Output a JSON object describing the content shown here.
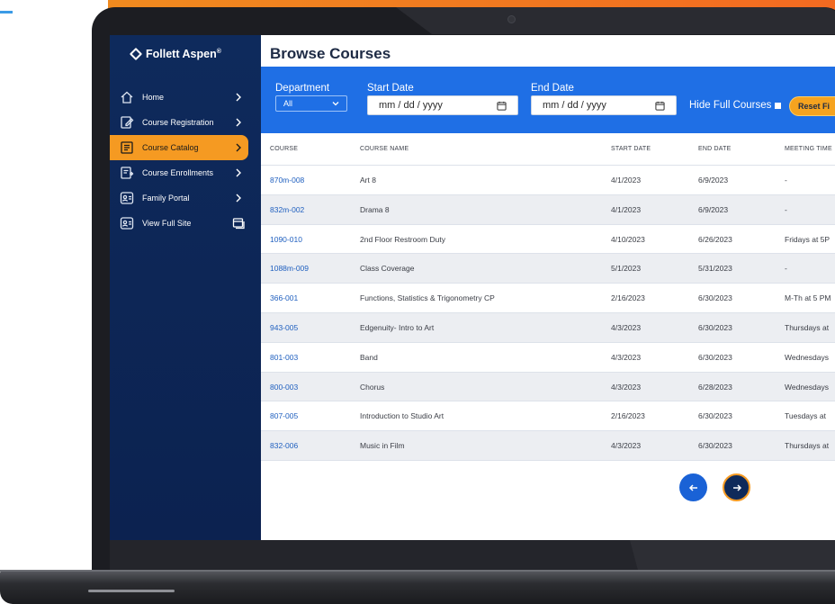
{
  "app": {
    "logo_text": "Follett Aspen",
    "logo_reg": "®"
  },
  "sidebar": {
    "items": [
      {
        "label": "Home",
        "icon": "home-icon",
        "active": false
      },
      {
        "label": "Course Registration",
        "icon": "edit-document-icon",
        "active": false
      },
      {
        "label": "Course Catalog",
        "icon": "catalog-icon",
        "active": true
      },
      {
        "label": "Course Enrollments",
        "icon": "enrollment-icon",
        "active": false
      },
      {
        "label": "Family Portal",
        "icon": "family-icon",
        "active": false
      },
      {
        "label": "View Full Site",
        "icon": "family-icon",
        "active": false
      }
    ]
  },
  "page": {
    "title": "Browse Courses"
  },
  "filters": {
    "department_label": "Department",
    "department_value": "All",
    "start_date_label": "Start Date",
    "start_date_placeholder": "mm / dd / yyyy",
    "end_date_label": "End Date",
    "end_date_placeholder": "mm / dd / yyyy",
    "hide_full_label": "Hide Full Courses",
    "reset_label": "Reset Fi"
  },
  "table": {
    "headers": [
      "COURSE",
      "COURSE NAME",
      "START DATE",
      "END DATE",
      "MEETING TIME"
    ],
    "rows": [
      [
        "870m-008",
        "Art 8",
        "4/1/2023",
        "6/9/2023",
        "-"
      ],
      [
        "832m-002",
        "Drama 8",
        "4/1/2023",
        "6/9/2023",
        "-"
      ],
      [
        "1090-010",
        "2nd Floor Restroom Duty",
        "4/10/2023",
        "6/26/2023",
        "Fridays at 5P"
      ],
      [
        "1088m-009",
        "Class Coverage",
        "5/1/2023",
        "5/31/2023",
        "-"
      ],
      [
        "366-001",
        "Functions, Statistics & Trigonometry CP",
        "2/16/2023",
        "6/30/2023",
        "M-Th at 5 PM"
      ],
      [
        "943-005",
        "Edgenuity- Intro to Art",
        "4/3/2023",
        "6/30/2023",
        "Thursdays at"
      ],
      [
        "801-003",
        "Band",
        "4/3/2023",
        "6/30/2023",
        "Wednesdays"
      ],
      [
        "800-003",
        "Chorus",
        "4/3/2023",
        "6/28/2023",
        "Wednesdays"
      ],
      [
        "807-005",
        "Introduction to Studio Art",
        "2/16/2023",
        "6/30/2023",
        "Tuesdays at"
      ],
      [
        "832-006",
        "Music in Film",
        "4/3/2023",
        "6/30/2023",
        "Thursdays at"
      ]
    ]
  },
  "pagination": {
    "prev_icon": "arrow-left-icon",
    "next_icon": "arrow-right-icon"
  },
  "colors": {
    "sidebar_bg": "#0e2a5c",
    "active_item": "#f59a22",
    "filter_bar": "#1f6fe5",
    "link": "#1f5fbf",
    "reset_button": "#f6a31f"
  }
}
